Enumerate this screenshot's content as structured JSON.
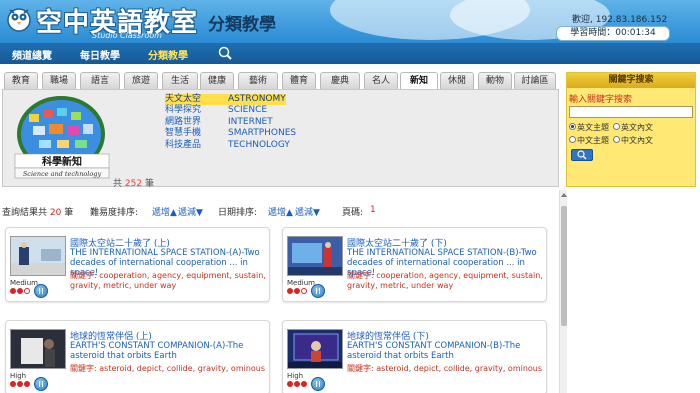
{
  "header": {
    "brand": "空中英語教室",
    "brand_sub": "Studio Classroom",
    "section_title": "分類教學",
    "welcome": "歡迎, 192.83.186.152",
    "study_time": "學習時間：00:01:34"
  },
  "nav": {
    "items": [
      {
        "label": "頻道總覽",
        "active": false
      },
      {
        "label": "每日教學",
        "active": false
      },
      {
        "label": "分類教學",
        "active": true
      }
    ]
  },
  "tabs": [
    {
      "label": "教育",
      "active": false
    },
    {
      "label": "職場",
      "active": false
    },
    {
      "label": "語言",
      "active": false
    },
    {
      "label": "旅遊",
      "active": false
    },
    {
      "label": "生活",
      "active": false
    },
    {
      "label": "健康",
      "active": false
    },
    {
      "label": "藝術",
      "active": false
    },
    {
      "label": "體育",
      "active": false
    },
    {
      "label": "慶典",
      "active": false
    },
    {
      "label": "名人",
      "active": false
    },
    {
      "label": "新知",
      "active": true
    },
    {
      "label": "休閒",
      "active": false
    },
    {
      "label": "動物",
      "active": false
    },
    {
      "label": "討論區",
      "active": false
    }
  ],
  "category": {
    "image_caption": "科學新知",
    "image_sub": "Science and technology",
    "total_prefix": "共",
    "total_count": "252",
    "total_suffix": "筆",
    "subcategories": [
      {
        "zh": "天文太空",
        "en": "ASTRONOMY",
        "selected": true
      },
      {
        "zh": "科學探究",
        "en": "SCIENCE",
        "selected": false
      },
      {
        "zh": "網路世界",
        "en": "INTERNET",
        "selected": false
      },
      {
        "zh": "智慧手機",
        "en": "SMARTPHONES",
        "selected": false
      },
      {
        "zh": "科技產品",
        "en": "TECHNOLOGY",
        "selected": false
      }
    ]
  },
  "keyword_search": {
    "title": "關鍵字搜索",
    "label": "輸入關鍵字搜索",
    "input_value": "",
    "options": [
      {
        "label": "英文主題",
        "checked": true
      },
      {
        "label": "英文內文",
        "checked": false
      },
      {
        "label": "中文主題",
        "checked": false
      },
      {
        "label": "中文內文",
        "checked": false
      }
    ],
    "button_icon": "search-icon"
  },
  "results": {
    "label": "查詢結果共",
    "count": "20",
    "unit": "筆",
    "difficulty_sort_label": "難易度排序:",
    "asc": "遞增▲",
    "desc": "遞減▼",
    "date_sort_label": "日期排序:",
    "page_label": "頁碼:",
    "page": "1"
  },
  "cards": [
    {
      "title_zh": "國際太空站二十歲了 (上)",
      "title_en": "THE INTERNATIONAL SPACE STATION-(A)-Two decades of international cooperation ... in space!",
      "kw_label": "關鍵字:",
      "keywords": "cooperation, agency, equipment, sustain, gravity, metric, under way",
      "level": "Medium",
      "level_value": 2,
      "thumb_bg": "#cfe0ec"
    },
    {
      "title_zh": "國際太空站二十歲了 (下)",
      "title_en": "THE INTERNATIONAL SPACE STATION-(B)-Two decades of international cooperation ... in space!",
      "kw_label": "關鍵字:",
      "keywords": "cooperation, agency, equipment, sustain, gravity, metric, under way",
      "level": "Medium",
      "level_value": 2,
      "thumb_bg": "#3a5ea8"
    },
    {
      "title_zh": "地球的恆常伴侶 (上)",
      "title_en": "EARTH'S CONSTANT COMPANION-(A)-The asteroid that orbits Earth",
      "kw_label": "關鍵字:",
      "keywords": "asteroid, depict, collide, gravity, ominous",
      "level": "High",
      "level_value": 3,
      "thumb_bg": "#2b2f3a"
    },
    {
      "title_zh": "地球的恆常伴侶 (下)",
      "title_en": "EARTH'S CONSTANT COMPANION-(B)-The asteroid that orbits Earth",
      "kw_label": "關鍵字:",
      "keywords": "asteroid, depict, collide, gravity, ominous",
      "level": "High",
      "level_value": 3,
      "thumb_bg": "#1a2d6b"
    }
  ]
}
